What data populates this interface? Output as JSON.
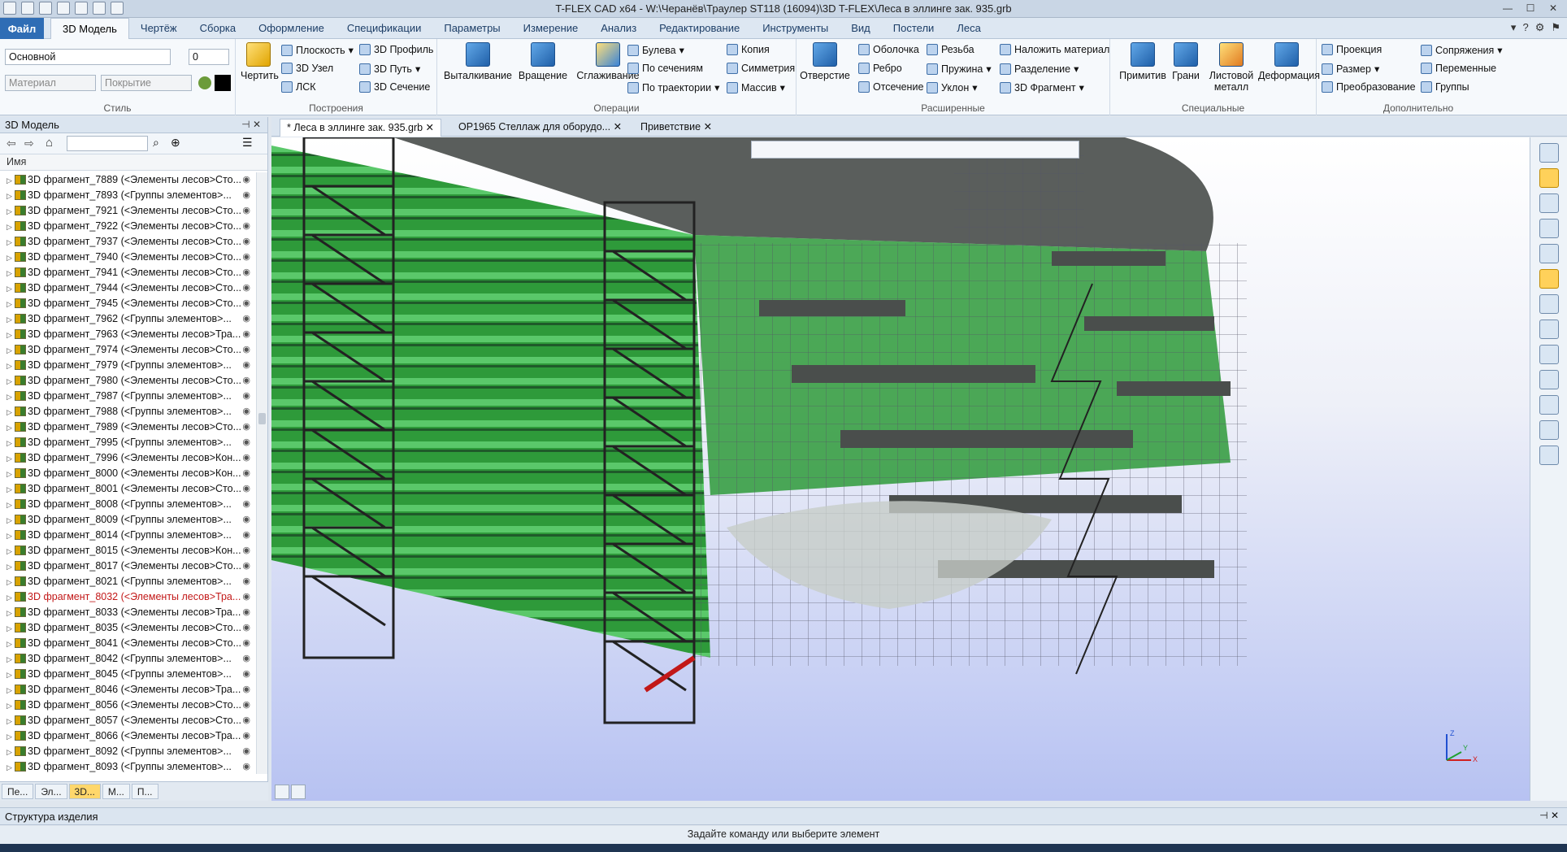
{
  "window": {
    "title": "T-FLEX CAD x64 - W:\\Черанёв\\Траулер ST118 (16094)\\3D T-FLEX\\Леса в эллинге зак. 935.grb"
  },
  "menu": {
    "file": "Файл",
    "tabs": [
      "3D Модель",
      "Чертёж",
      "Сборка",
      "Оформление",
      "Спецификации",
      "Параметры",
      "Измерение",
      "Анализ",
      "Редактирование",
      "Инструменты",
      "Вид",
      "Постели",
      "Леса"
    ],
    "active_tab": "3D Модель"
  },
  "ribbon": {
    "style": {
      "title": "Стиль",
      "layer": "Основной",
      "number": "0",
      "material": "Материал",
      "coating": "Покрытие"
    },
    "build": {
      "title": "Построения",
      "draw": "Чертить",
      "plane": "Плоскость",
      "node": "3D Узел",
      "lsk": "ЛСК",
      "profile": "3D Профиль",
      "path": "3D Путь",
      "section": "3D Сечение"
    },
    "ops": {
      "title": "Операции",
      "extrude": "Выталкивание",
      "rotate": "Вращение",
      "smooth": "Сглаживание",
      "boolean": "Булева",
      "by_sections": "По сечениям",
      "by_path": "По траектории",
      "copy": "Копия",
      "symmetry": "Симметрия",
      "array": "Массив"
    },
    "ext": {
      "title": "Расширенные",
      "hole": "Отверстие",
      "shell": "Оболочка",
      "rib": "Ребро",
      "cut": "Отсечение",
      "thread": "Резьба",
      "spring": "Пружина",
      "slope": "Уклон",
      "apply_material": "Наложить материал",
      "split": "Разделение",
      "fragment": "3D Фрагмент"
    },
    "special": {
      "title": "Специальные",
      "primitives": "Примитив",
      "faces": "Грани",
      "sheet_metal": "Листовой металл",
      "deform": "Деформация"
    },
    "extra": {
      "title": "Дополнительно",
      "projection": "Проекция",
      "dimension": "Размер",
      "transform": "Преобразование",
      "mates": "Сопряжения",
      "variables": "Переменные",
      "groups": "Группы"
    }
  },
  "panel": {
    "title": "3D Модель",
    "col_name": "Имя",
    "items": [
      "3D фрагмент_7889 (<Элементы лесов>Сто...",
      "3D фрагмент_7893 (<Группы элементов>...",
      "3D фрагмент_7921 (<Элементы лесов>Сто...",
      "3D фрагмент_7922 (<Элементы лесов>Сто...",
      "3D фрагмент_7937 (<Элементы лесов>Сто...",
      "3D фрагмент_7940 (<Элементы лесов>Сто...",
      "3D фрагмент_7941 (<Элементы лесов>Сто...",
      "3D фрагмент_7944 (<Элементы лесов>Сто...",
      "3D фрагмент_7945 (<Элементы лесов>Сто...",
      "3D фрагмент_7962 (<Группы элементов>...",
      "3D фрагмент_7963 (<Элементы лесов>Тра...",
      "3D фрагмент_7974 (<Элементы лесов>Сто...",
      "3D фрагмент_7979 (<Группы элементов>...",
      "3D фрагмент_7980 (<Элементы лесов>Сто...",
      "3D фрагмент_7987 (<Группы элементов>...",
      "3D фрагмент_7988 (<Группы элементов>...",
      "3D фрагмент_7989 (<Элементы лесов>Сто...",
      "3D фрагмент_7995 (<Группы элементов>...",
      "3D фрагмент_7996 (<Элементы лесов>Кон...",
      "3D фрагмент_8000 (<Элементы лесов>Кон...",
      "3D фрагмент_8001 (<Элементы лесов>Сто...",
      "3D фрагмент_8008 (<Группы элементов>...",
      "3D фрагмент_8009 (<Группы элементов>...",
      "3D фрагмент_8014 (<Группы элементов>...",
      "3D фрагмент_8015 (<Элементы лесов>Кон...",
      "3D фрагмент_8017 (<Элементы лесов>Сто...",
      "3D фрагмент_8021 (<Группы элементов>...",
      "3D фрагмент_8032 (<Элементы лесов>Тра...",
      "3D фрагмент_8033 (<Элементы лесов>Тра...",
      "3D фрагмент_8035 (<Элементы лесов>Сто...",
      "3D фрагмент_8041 (<Элементы лесов>Сто...",
      "3D фрагмент_8042 (<Группы элементов>...",
      "3D фрагмент_8045 (<Группы элементов>...",
      "3D фрагмент_8046 (<Элементы лесов>Тра...",
      "3D фрагмент_8056 (<Элементы лесов>Сто...",
      "3D фрагмент_8057 (<Элементы лесов>Сто...",
      "3D фрагмент_8066 (<Элементы лесов>Тра...",
      "3D фрагмент_8092 (<Группы элементов>...",
      "3D фрагмент_8093 (<Группы элементов>..."
    ],
    "highlight_index": 27,
    "bottom_tabs": [
      "Пе...",
      "Эл...",
      "3D...",
      "М...",
      "П..."
    ]
  },
  "doc_tabs": [
    "* Леса в эллинге зак. 935.grb",
    "ОР1965 Стеллаж для оборудо...",
    "Приветствие"
  ],
  "structure": "Структура изделия",
  "status": "Задайте команду или выберите элемент",
  "axes": {
    "x": "X",
    "y": "Y",
    "z": "Z"
  },
  "colors": {
    "accent": "#2f6db5",
    "hull_green": "#2e9a3a",
    "deck_gray": "#5a5e5c",
    "highlight_red": "#c21818"
  }
}
